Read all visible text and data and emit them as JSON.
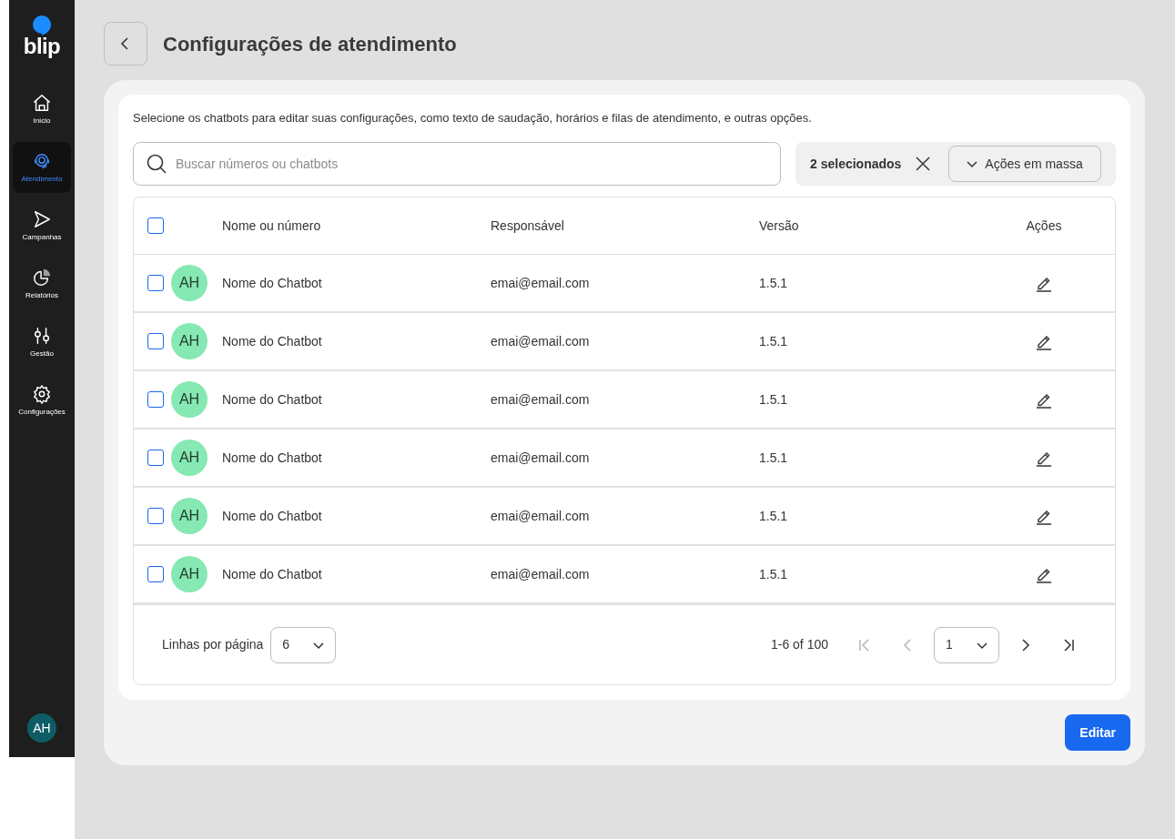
{
  "sidebar": {
    "logo": "blip",
    "items": [
      {
        "label": "Início",
        "selected": false
      },
      {
        "label": "Atendimento",
        "selected": true
      },
      {
        "label": "Campanhas",
        "selected": false
      },
      {
        "label": "Relatórios",
        "selected": false
      },
      {
        "label": "Gestão",
        "selected": false
      },
      {
        "label": "Configurações",
        "selected": false
      }
    ],
    "user_avatar": "AH"
  },
  "header": {
    "title": "Configurações de atendimento"
  },
  "description": "Selecione os chatbots para editar suas configurações, como texto de saudação, horários e filas de atendimento, e outras opções.",
  "search": {
    "placeholder": "Buscar números ou chatbots"
  },
  "selection": {
    "count": "2 selecionados",
    "bulk_actions": "Ações em massa"
  },
  "table": {
    "select_all_checked": false,
    "columns": [
      "Nome ou número",
      "Responsável",
      "Versão",
      "Ações"
    ],
    "rows": [
      {
        "checked": false,
        "avatar": "AH",
        "name": "Nome do Chatbot",
        "owner": "emai@email.com",
        "version": "1.5.1"
      },
      {
        "checked": false,
        "avatar": "AH",
        "name": "Nome do Chatbot",
        "owner": "emai@email.com",
        "version": "1.5.1"
      },
      {
        "checked": false,
        "avatar": "AH",
        "name": "Nome do Chatbot",
        "owner": "emai@email.com",
        "version": "1.5.1"
      },
      {
        "checked": false,
        "avatar": "AH",
        "name": "Nome do Chatbot",
        "owner": "emai@email.com",
        "version": "1.5.1"
      },
      {
        "checked": false,
        "avatar": "AH",
        "name": "Nome do Chatbot",
        "owner": "emai@email.com",
        "version": "1.5.1"
      },
      {
        "checked": false,
        "avatar": "AH",
        "name": "Nome do Chatbot",
        "owner": "emai@email.com",
        "version": "1.5.1"
      }
    ]
  },
  "pagination": {
    "rows_label": "Linhas por página",
    "rows_per_page": "6",
    "range": "1-6 of 100",
    "page": "1",
    "first_disabled": true,
    "prev_disabled": true,
    "next_disabled": false,
    "last_disabled": false
  },
  "edit_button": "Editar"
}
